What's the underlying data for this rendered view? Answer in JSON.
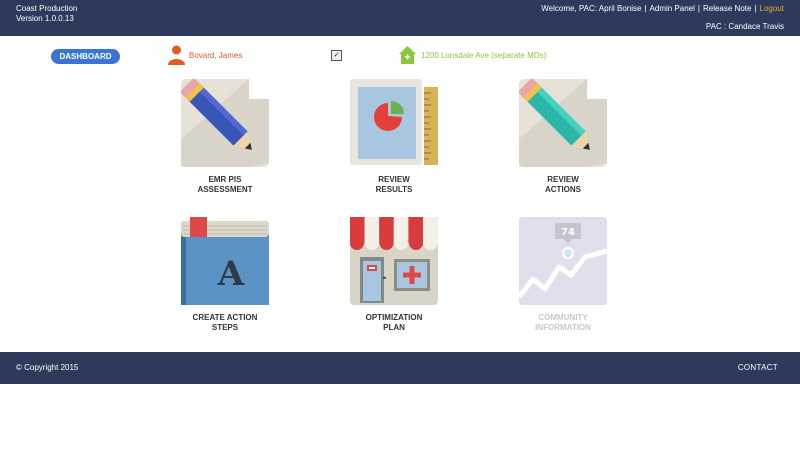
{
  "header": {
    "app_name": "Coast Production",
    "version": "Version 1.0.0.13",
    "welcome": "Welcome, PAC: April Bonise",
    "admin_panel": "Admin Panel",
    "release_note": "Release Note",
    "logout": "Logout",
    "pac_line": "PAC : Candace Travis"
  },
  "toolbar": {
    "dashboard_label": "DASHBOARD",
    "patient_name": "Bovard, James",
    "dropdown_glyph": "✓",
    "address": "1200 Lonsdale Ave (separate MDs)"
  },
  "tiles": [
    {
      "line1": "EMR PIS",
      "line2": "ASSESSMENT"
    },
    {
      "line1": "REVIEW",
      "line2": "RESULTS"
    },
    {
      "line1": "REVIEW",
      "line2": "ACTIONS"
    },
    {
      "line1": "CREATE ACTION",
      "line2": "STEPS"
    },
    {
      "line1": "OPTIMIZATION",
      "line2": "PLAN"
    },
    {
      "line1": "COMMUNITY",
      "line2": "INFORMATION",
      "badge": "74"
    }
  ],
  "footer": {
    "copyright": "© Copyright 2015",
    "contact": "CONTACT"
  },
  "colors": {
    "navy": "#2d3a5c",
    "dashboard_blue": "#3b74d6",
    "patient_orange": "#e05a28",
    "address_green": "#8cc63f",
    "logout_orange": "#f0a830"
  }
}
